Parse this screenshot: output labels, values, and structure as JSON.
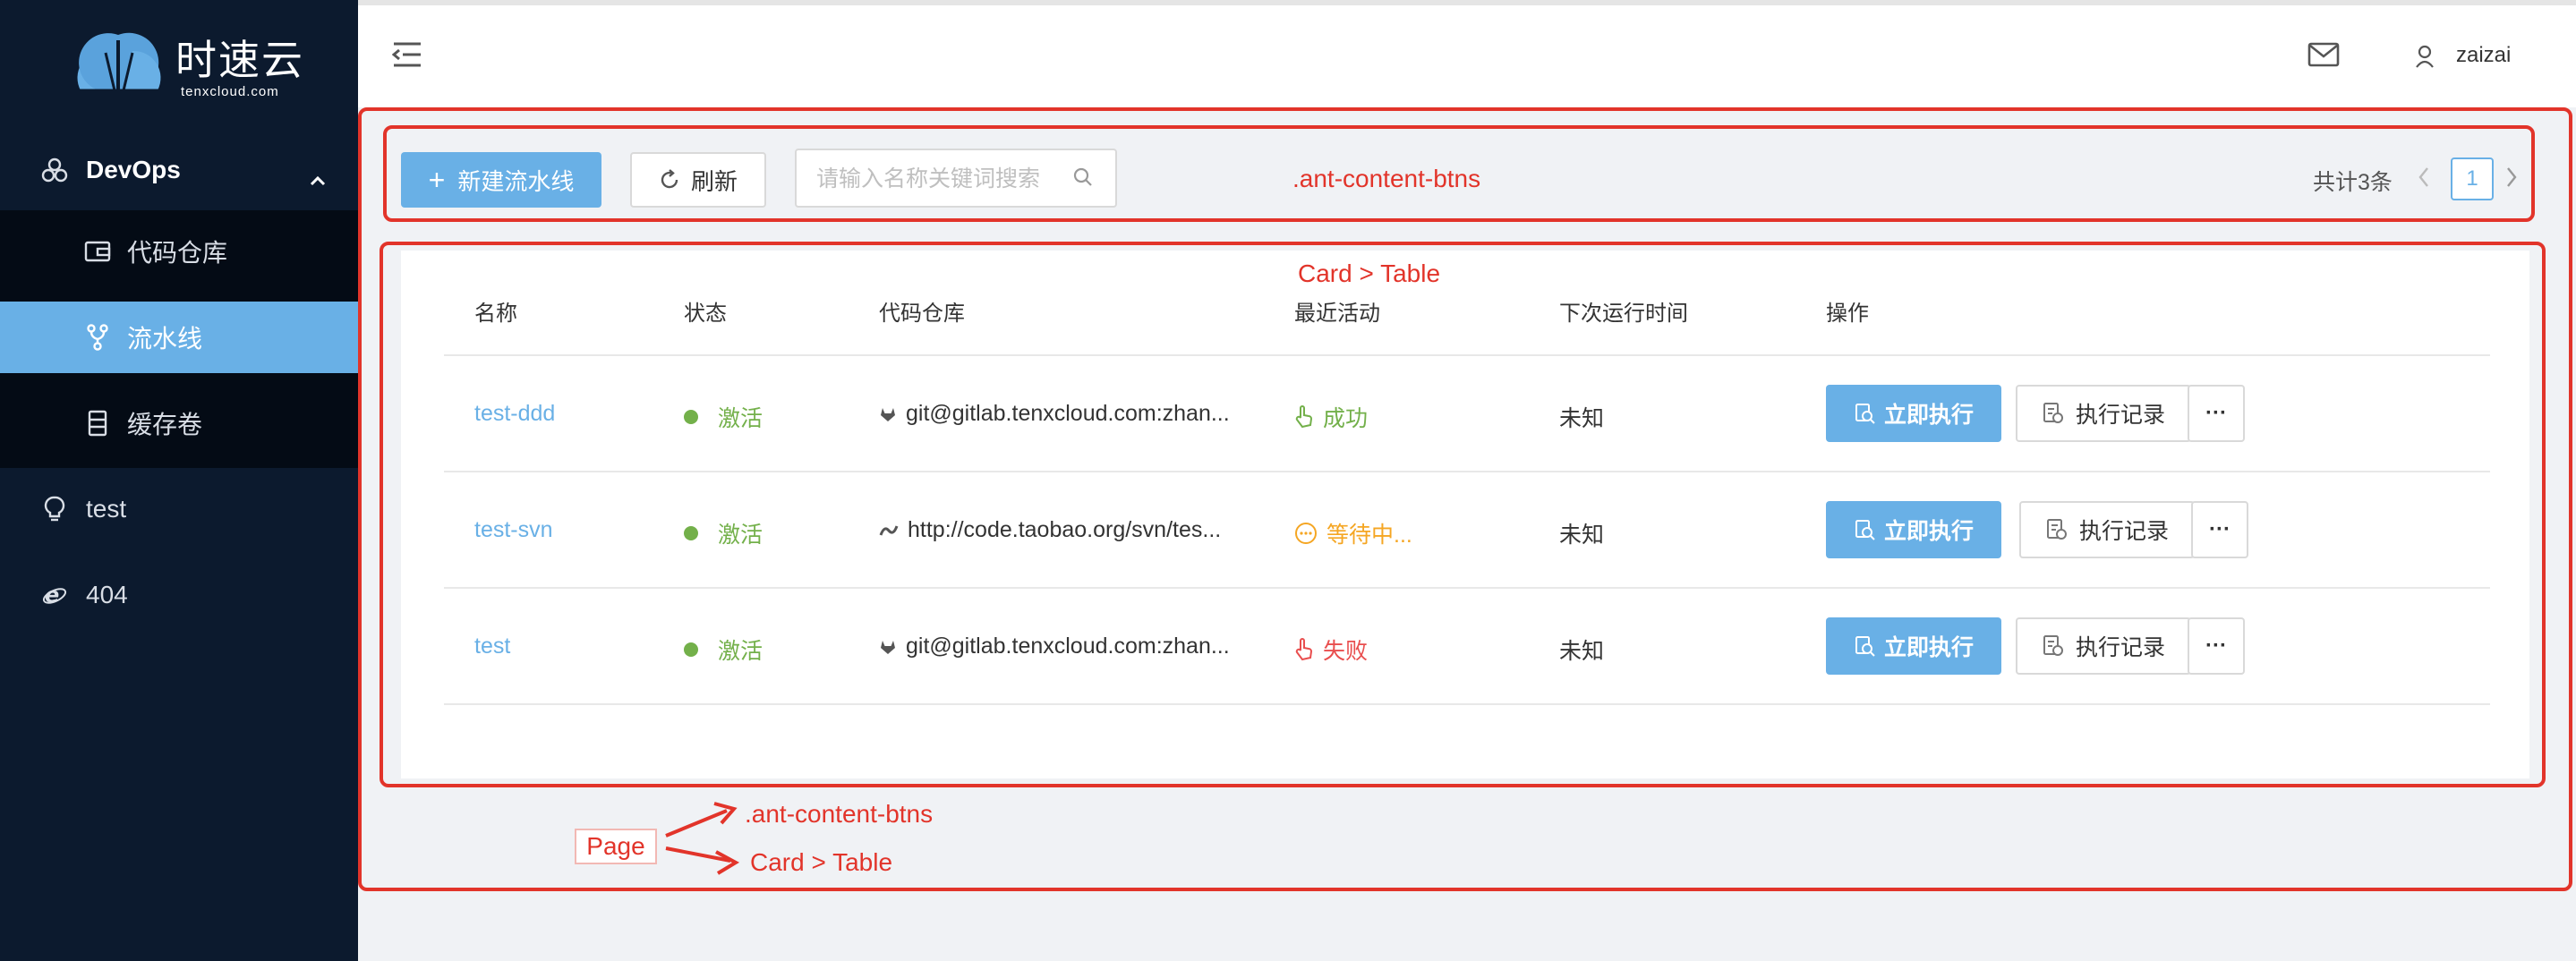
{
  "brand": {
    "name_cn": "时速云",
    "name_en": "tenxcloud.com",
    "color": "#69b0e6"
  },
  "sidebar": {
    "group": {
      "label": "DevOps",
      "icon": "devops-icon"
    },
    "items": [
      {
        "label": "代码仓库",
        "icon": "wallet-icon",
        "active": false
      },
      {
        "label": "流水线",
        "icon": "fork-icon",
        "active": true
      },
      {
        "label": "缓存卷",
        "icon": "database-icon",
        "active": false
      }
    ],
    "extra": [
      {
        "label": "test",
        "icon": "bulb-icon"
      },
      {
        "label": "404",
        "icon": "ie-icon"
      }
    ]
  },
  "header": {
    "menu_icon": "menu-fold-icon",
    "mail_icon": "mail-icon",
    "user_icon": "user-icon",
    "username": "zaizai"
  },
  "toolbar": {
    "new_label": "新建流水线",
    "refresh_label": "刷新",
    "search_placeholder": "请输入名称关键词搜索",
    "search_value": "",
    "total_text": "共计3条",
    "page_current": "1"
  },
  "table": {
    "columns": [
      "名称",
      "状态",
      "代码仓库",
      "最近活动",
      "下次运行时间",
      "操作"
    ],
    "rows": [
      {
        "name": "test-ddd",
        "status": "激活",
        "repo": "git@gitlab.tenxcloud.com:zhan...",
        "repo_icon": "gitlab-icon",
        "activity": "成功",
        "activity_state": "success",
        "next_run": "未知",
        "run_label": "立即执行",
        "log_label": "执行记录",
        "more_label": "···"
      },
      {
        "name": "test-svn",
        "status": "激活",
        "repo": "http://code.taobao.org/svn/tes...",
        "repo_icon": "svn-icon",
        "activity": "等待中...",
        "activity_state": "waiting",
        "next_run": "未知",
        "run_label": "立即执行",
        "log_label": "执行记录",
        "more_label": "···"
      },
      {
        "name": "test",
        "status": "激活",
        "repo": "git@gitlab.tenxcloud.com:zhan...",
        "repo_icon": "gitlab-icon",
        "activity": "失败",
        "activity_state": "fail",
        "next_run": "未知",
        "run_label": "立即执行",
        "log_label": "执行记录",
        "more_label": "···"
      }
    ]
  },
  "annotations": {
    "btns_label": ".ant-content-btns",
    "table_label": "Card > Table",
    "page_label": "Page",
    "arrow_btns": ".ant-content-btns",
    "arrow_table": "Card > Table",
    "color": "#e2342a"
  },
  "colors": {
    "sidebar_bg": "#0c1a2e",
    "active_bg": "#69b0e6",
    "success": "#73b04a",
    "waiting": "#f5a623",
    "fail": "#e94e4e"
  }
}
